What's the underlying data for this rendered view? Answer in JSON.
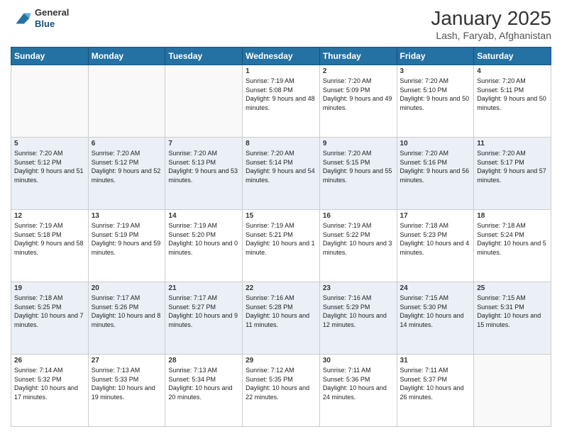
{
  "header": {
    "logo_general": "General",
    "logo_blue": "Blue",
    "title": "January 2025",
    "subtitle": "Lash, Faryab, Afghanistan"
  },
  "days_of_week": [
    "Sunday",
    "Monday",
    "Tuesday",
    "Wednesday",
    "Thursday",
    "Friday",
    "Saturday"
  ],
  "weeks": [
    [
      {
        "day": "",
        "info": ""
      },
      {
        "day": "",
        "info": ""
      },
      {
        "day": "",
        "info": ""
      },
      {
        "day": "1",
        "info": "Sunrise: 7:19 AM\nSunset: 5:08 PM\nDaylight: 9 hours\nand 48 minutes."
      },
      {
        "day": "2",
        "info": "Sunrise: 7:20 AM\nSunset: 5:09 PM\nDaylight: 9 hours\nand 49 minutes."
      },
      {
        "day": "3",
        "info": "Sunrise: 7:20 AM\nSunset: 5:10 PM\nDaylight: 9 hours\nand 50 minutes."
      },
      {
        "day": "4",
        "info": "Sunrise: 7:20 AM\nSunset: 5:11 PM\nDaylight: 9 hours\nand 50 minutes."
      }
    ],
    [
      {
        "day": "5",
        "info": "Sunrise: 7:20 AM\nSunset: 5:12 PM\nDaylight: 9 hours\nand 51 minutes."
      },
      {
        "day": "6",
        "info": "Sunrise: 7:20 AM\nSunset: 5:12 PM\nDaylight: 9 hours\nand 52 minutes."
      },
      {
        "day": "7",
        "info": "Sunrise: 7:20 AM\nSunset: 5:13 PM\nDaylight: 9 hours\nand 53 minutes."
      },
      {
        "day": "8",
        "info": "Sunrise: 7:20 AM\nSunset: 5:14 PM\nDaylight: 9 hours\nand 54 minutes."
      },
      {
        "day": "9",
        "info": "Sunrise: 7:20 AM\nSunset: 5:15 PM\nDaylight: 9 hours\nand 55 minutes."
      },
      {
        "day": "10",
        "info": "Sunrise: 7:20 AM\nSunset: 5:16 PM\nDaylight: 9 hours\nand 56 minutes."
      },
      {
        "day": "11",
        "info": "Sunrise: 7:20 AM\nSunset: 5:17 PM\nDaylight: 9 hours\nand 57 minutes."
      }
    ],
    [
      {
        "day": "12",
        "info": "Sunrise: 7:19 AM\nSunset: 5:18 PM\nDaylight: 9 hours\nand 58 minutes."
      },
      {
        "day": "13",
        "info": "Sunrise: 7:19 AM\nSunset: 5:19 PM\nDaylight: 9 hours\nand 59 minutes."
      },
      {
        "day": "14",
        "info": "Sunrise: 7:19 AM\nSunset: 5:20 PM\nDaylight: 10 hours\nand 0 minutes."
      },
      {
        "day": "15",
        "info": "Sunrise: 7:19 AM\nSunset: 5:21 PM\nDaylight: 10 hours\nand 1 minute."
      },
      {
        "day": "16",
        "info": "Sunrise: 7:19 AM\nSunset: 5:22 PM\nDaylight: 10 hours\nand 3 minutes."
      },
      {
        "day": "17",
        "info": "Sunrise: 7:18 AM\nSunset: 5:23 PM\nDaylight: 10 hours\nand 4 minutes."
      },
      {
        "day": "18",
        "info": "Sunrise: 7:18 AM\nSunset: 5:24 PM\nDaylight: 10 hours\nand 5 minutes."
      }
    ],
    [
      {
        "day": "19",
        "info": "Sunrise: 7:18 AM\nSunset: 5:25 PM\nDaylight: 10 hours\nand 7 minutes."
      },
      {
        "day": "20",
        "info": "Sunrise: 7:17 AM\nSunset: 5:26 PM\nDaylight: 10 hours\nand 8 minutes."
      },
      {
        "day": "21",
        "info": "Sunrise: 7:17 AM\nSunset: 5:27 PM\nDaylight: 10 hours\nand 9 minutes."
      },
      {
        "day": "22",
        "info": "Sunrise: 7:16 AM\nSunset: 5:28 PM\nDaylight: 10 hours\nand 11 minutes."
      },
      {
        "day": "23",
        "info": "Sunrise: 7:16 AM\nSunset: 5:29 PM\nDaylight: 10 hours\nand 12 minutes."
      },
      {
        "day": "24",
        "info": "Sunrise: 7:15 AM\nSunset: 5:30 PM\nDaylight: 10 hours\nand 14 minutes."
      },
      {
        "day": "25",
        "info": "Sunrise: 7:15 AM\nSunset: 5:31 PM\nDaylight: 10 hours\nand 15 minutes."
      }
    ],
    [
      {
        "day": "26",
        "info": "Sunrise: 7:14 AM\nSunset: 5:32 PM\nDaylight: 10 hours\nand 17 minutes."
      },
      {
        "day": "27",
        "info": "Sunrise: 7:13 AM\nSunset: 5:33 PM\nDaylight: 10 hours\nand 19 minutes."
      },
      {
        "day": "28",
        "info": "Sunrise: 7:13 AM\nSunset: 5:34 PM\nDaylight: 10 hours\nand 20 minutes."
      },
      {
        "day": "29",
        "info": "Sunrise: 7:12 AM\nSunset: 5:35 PM\nDaylight: 10 hours\nand 22 minutes."
      },
      {
        "day": "30",
        "info": "Sunrise: 7:11 AM\nSunset: 5:36 PM\nDaylight: 10 hours\nand 24 minutes."
      },
      {
        "day": "31",
        "info": "Sunrise: 7:11 AM\nSunset: 5:37 PM\nDaylight: 10 hours\nand 26 minutes."
      },
      {
        "day": "",
        "info": ""
      }
    ]
  ]
}
